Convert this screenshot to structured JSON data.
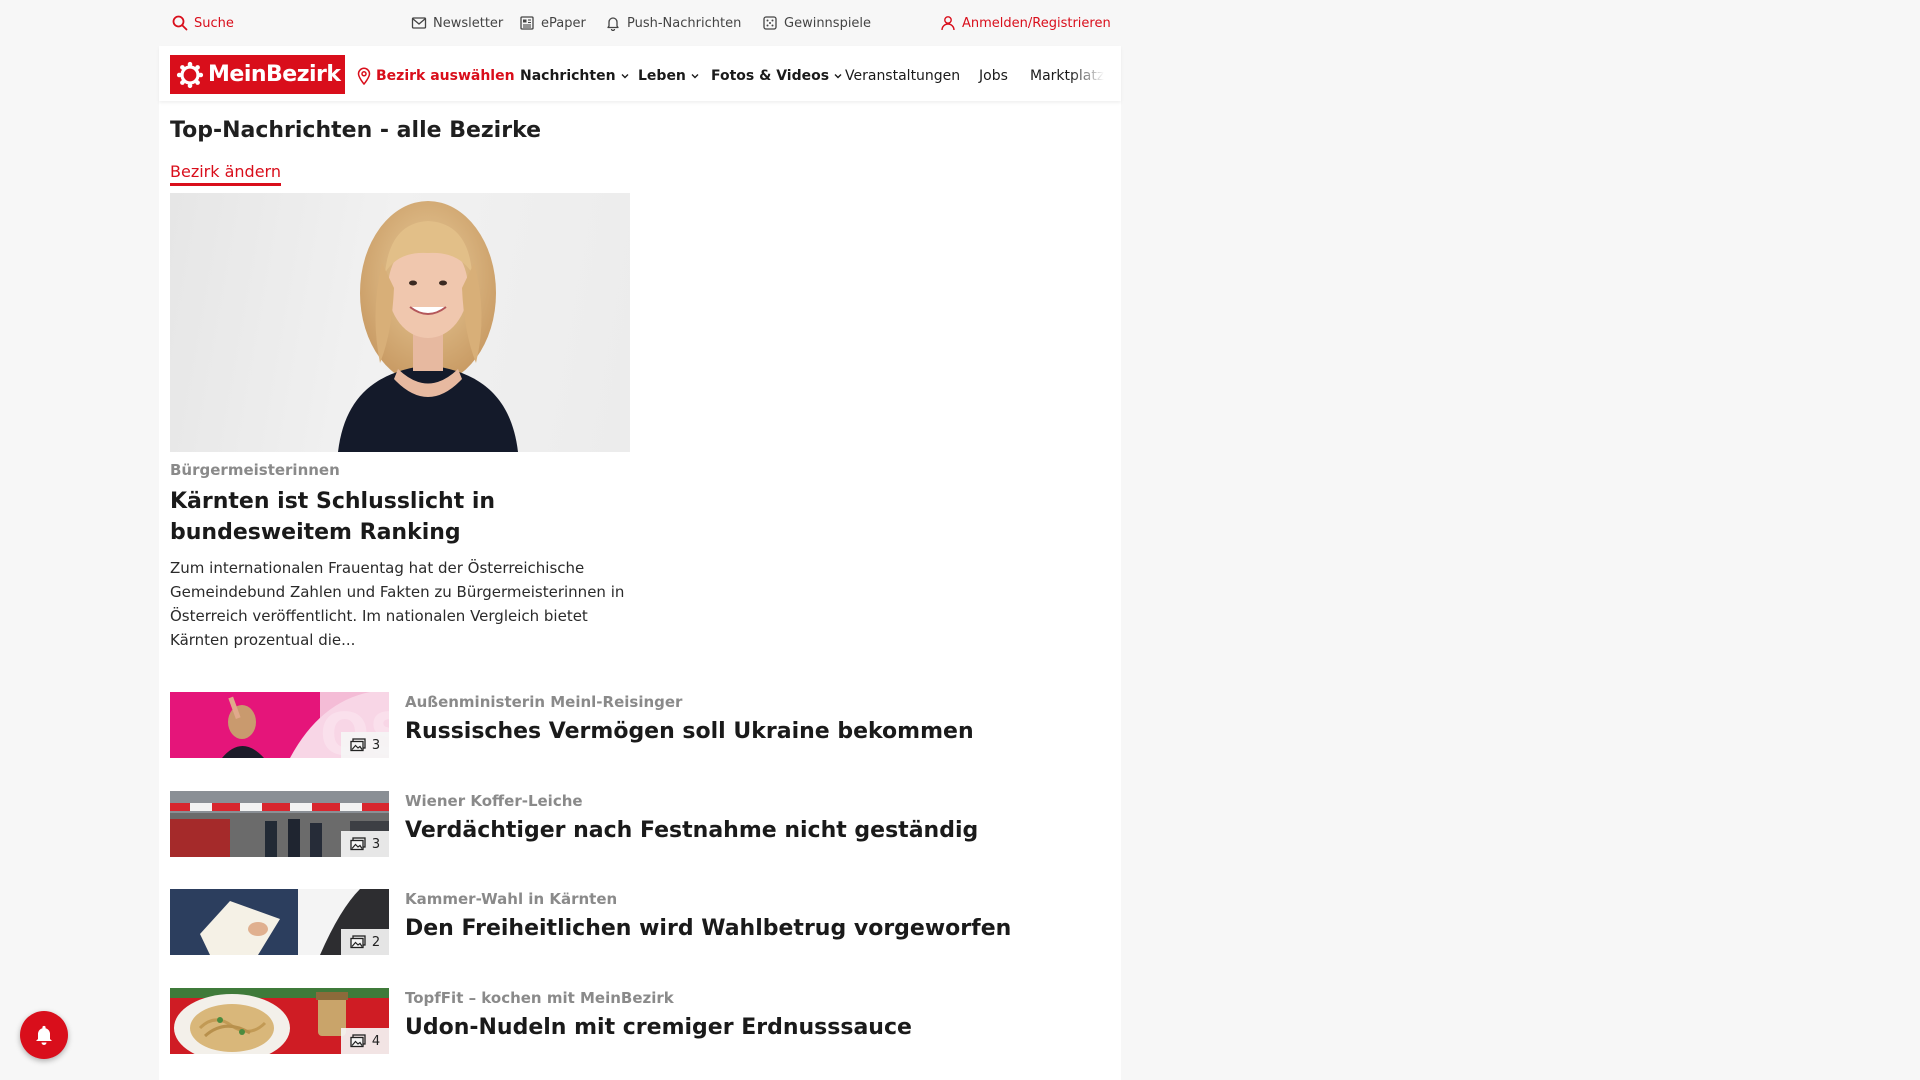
{
  "colors": {
    "brand": "#d90e1b",
    "kicker": "#8a8a8a",
    "background": "#f7f7f7"
  },
  "topbar": {
    "search": {
      "label": "Suche",
      "icon": "search-icon"
    },
    "newsletter": {
      "label": "Newsletter",
      "icon": "mail-icon"
    },
    "epaper": {
      "label": "ePaper",
      "icon": "newspaper-icon"
    },
    "push": {
      "label": "Push-Nachrichten",
      "icon": "bell-icon"
    },
    "contests": {
      "label": "Gewinnspiele",
      "icon": "dice-icon"
    },
    "login": {
      "label": "Anmelden/Registrieren",
      "icon": "user-icon"
    }
  },
  "nav": {
    "logo": "MeinBezirk",
    "district": "Bezirk auswählen",
    "items": [
      {
        "label": "Nachrichten",
        "dropdown": true
      },
      {
        "label": "Leben",
        "dropdown": true
      },
      {
        "label": "Fotos & Videos",
        "dropdown": true
      },
      {
        "label": "Veranstaltungen",
        "dropdown": false
      },
      {
        "label": "Jobs",
        "dropdown": false
      },
      {
        "label": "Marktplatz",
        "dropdown": false
      }
    ]
  },
  "section": {
    "title": "Top-Nachrichten - alle Bezirke",
    "change_link": "Bezirk ändern"
  },
  "lead": {
    "kicker": "Bürgermeisterinnen",
    "title": "Kärnten ist Schlusslicht in bundesweitem Ranking",
    "teaser": "Zum internationalen Frauentag hat der Österreichische Gemeindebund Zahlen und Fakten zu Bürgermeisterinnen in Österreich veröffentlicht. Im nationalen Vergleich bietet Kärnten prozentual die..."
  },
  "articles": [
    {
      "kicker": "Außenministerin Meinl-Reisinger",
      "title": "Russisches Vermögen soll Ukraine bekommen",
      "photo_count": "3"
    },
    {
      "kicker": "Wiener Koffer-Leiche",
      "title": "Verdächtiger nach Festnahme nicht geständig",
      "photo_count": "3"
    },
    {
      "kicker": "Kammer-Wahl in Kärnten",
      "title": "Den Freiheitlichen wird Wahlbetrug vorgeworfen",
      "photo_count": "2"
    },
    {
      "kicker": "TopfFit – kochen mit MeinBezirk",
      "title": "Udon-Nudeln mit cremiger Erdnusssauce",
      "photo_count": "4"
    }
  ]
}
